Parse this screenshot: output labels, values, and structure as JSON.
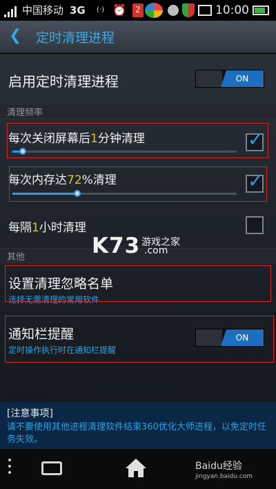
{
  "status_bar": {
    "carrier": "中国移动",
    "network": "3G",
    "notification_count": "2",
    "time": "10:00",
    "icons": [
      "signal-icon",
      "wifi-icon",
      "alarm-icon",
      "notification-badge",
      "app-icon",
      "circle-icon",
      "shield-icon",
      "image-icon",
      "battery-icon"
    ]
  },
  "title_bar": {
    "back_icon": "chevron-left-icon",
    "title": "定时清理进程"
  },
  "main_toggle": {
    "label": "启用定时清理进程",
    "state": "ON"
  },
  "section_frequency": {
    "header": "清理频率",
    "items": [
      {
        "prefix": "每次关闭屏幕后",
        "value": "1",
        "suffix": "分钟清理",
        "checked": true,
        "slider_fraction": 0.05
      },
      {
        "prefix": "每次内存达",
        "value": "72",
        "suffix": "%清理",
        "checked": true,
        "slider_fraction": 0.28
      },
      {
        "prefix": "每隔",
        "value": "1",
        "suffix": "小时清理",
        "checked": false
      }
    ]
  },
  "section_other": {
    "header": "其他",
    "ignore_list": {
      "title": "设置清理忽略名单",
      "subtitle": "选择无需清理的常用软件"
    },
    "notify_bar": {
      "title": "通知栏提醒",
      "subtitle": "定时操作执行时在通知栏提醒",
      "state": "ON"
    }
  },
  "note": {
    "title": "[注意事项]",
    "body": "请不要使用其他进程清理软件结束360优化大师进程，以免定时任务失效。"
  },
  "watermark": {
    "logo": "K73",
    "text": "游戏之家",
    "domain": ".com"
  },
  "baidu_watermark": {
    "brand": "Baidu经验",
    "url": "jingyan.baidu.com"
  },
  "colors": {
    "accent": "#2d9de5",
    "highlight": "#e3c32e",
    "toggle_on": "#1c6fbe",
    "annotation": "#d82424"
  }
}
